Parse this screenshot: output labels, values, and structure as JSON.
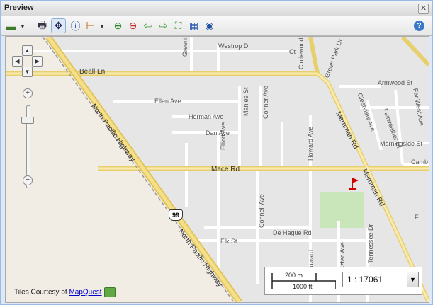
{
  "window": {
    "title": "Preview",
    "close_glyph": "✕"
  },
  "toolbar": {
    "buttons": [
      {
        "name": "layers-icon",
        "glyph": "▬"
      },
      {
        "name": "print-icon",
        "glyph": "🖶"
      },
      {
        "name": "pan-icon",
        "glyph": "✥"
      },
      {
        "name": "info-icon",
        "glyph": "ⓘ"
      },
      {
        "name": "measure-icon",
        "glyph": "⊢"
      },
      {
        "name": "zoom-in-icon",
        "glyph": "⊕"
      },
      {
        "name": "zoom-out-icon",
        "glyph": "⊖"
      },
      {
        "name": "back-arrow-icon",
        "glyph": "⇦"
      },
      {
        "name": "forward-arrow-icon",
        "glyph": "⇨"
      },
      {
        "name": "zoom-extent-icon",
        "glyph": "⛶"
      },
      {
        "name": "table-icon",
        "glyph": "▦"
      },
      {
        "name": "globe-icon",
        "glyph": "◉"
      },
      {
        "name": "help-icon",
        "glyph": "?"
      }
    ]
  },
  "map": {
    "streets": [
      {
        "text": "Westrop Dr"
      },
      {
        "text": "Greentree Dr"
      },
      {
        "text": "Circlewood"
      },
      {
        "text": "Green Park Dr"
      },
      {
        "text": "Beall Ln"
      },
      {
        "text": "Ellen Ave"
      },
      {
        "text": "Herman Ave"
      },
      {
        "text": "Dan Ave"
      },
      {
        "text": "Manlee St"
      },
      {
        "text": "Conner Ave"
      },
      {
        "text": "Elliott Ave"
      },
      {
        "text": "Mace Rd"
      },
      {
        "text": "Connell Ave"
      },
      {
        "text": "De Hague Rd"
      },
      {
        "text": "Elk St"
      },
      {
        "text": "Howard Ave"
      },
      {
        "text": "Aztec Ave"
      },
      {
        "text": "Merriman Rd"
      },
      {
        "text": "Armwood St"
      },
      {
        "text": "Clearview Ave"
      },
      {
        "text": "Fairweather Dr"
      },
      {
        "text": "Morningside St"
      },
      {
        "text": "Far West Ave"
      },
      {
        "text": "North Pacific Highway"
      },
      {
        "text": "North Pacific Highway"
      },
      {
        "text": "Merriman Rd"
      },
      {
        "text": "Tennessee Dr"
      },
      {
        "text": "Howard"
      },
      {
        "text": "Camb"
      },
      {
        "text": "F"
      },
      {
        "text": "Ct"
      }
    ],
    "route_shield": "99",
    "attribution": {
      "prefix": "Tiles Courtesy of ",
      "link": "MapQuest"
    },
    "scale": {
      "top": "200 m",
      "bottom": "1000 ft",
      "ratio": "1 : 17061"
    },
    "colors": {
      "road": "#f4e9b8",
      "land": "#e9e9e9",
      "park": "#c8e6b9",
      "flag": "#cc0000"
    }
  }
}
